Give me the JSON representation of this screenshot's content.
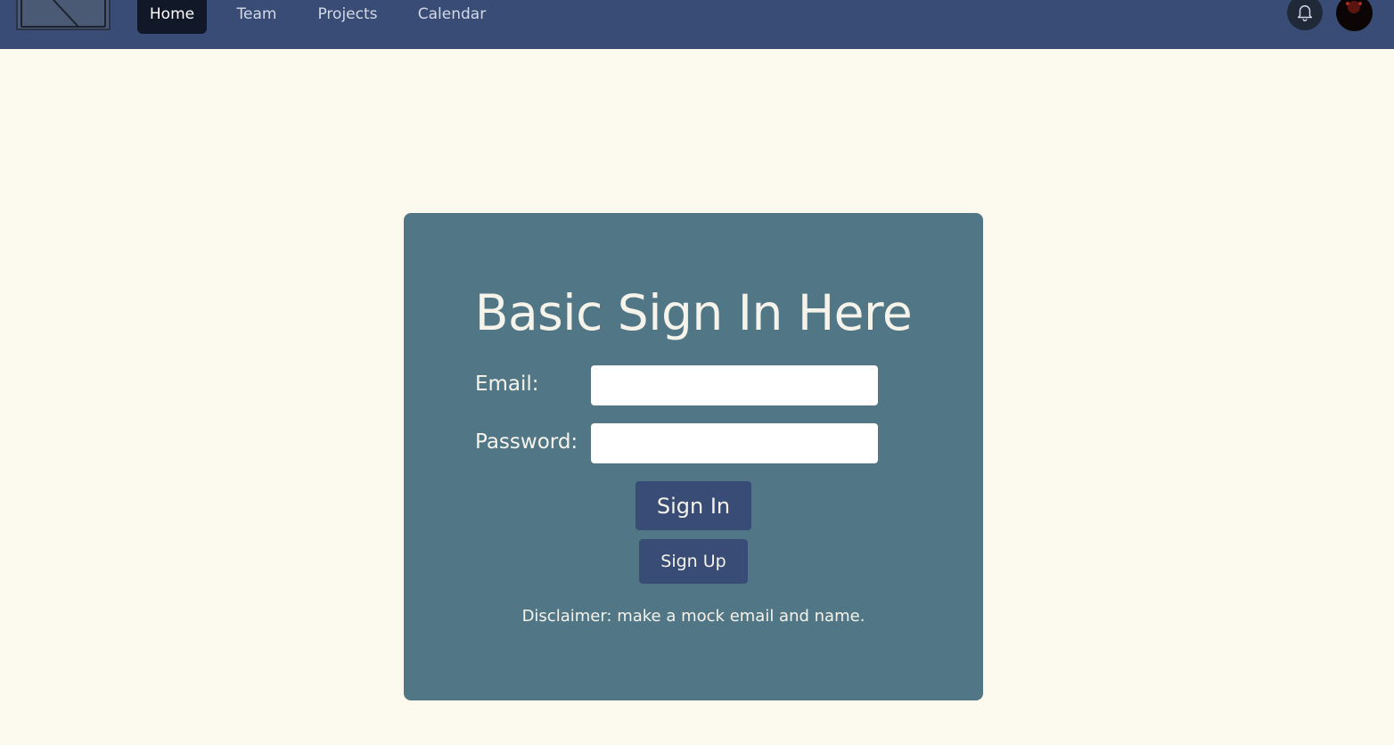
{
  "nav": {
    "items": [
      {
        "label": "Home",
        "active": true
      },
      {
        "label": "Team",
        "active": false
      },
      {
        "label": "Projects",
        "active": false
      },
      {
        "label": "Calendar",
        "active": false
      }
    ],
    "notification_icon": "bell-icon",
    "avatar": "user-avatar"
  },
  "form": {
    "title": "Basic Sign In Here",
    "email_label": "Email:",
    "email_value": "",
    "password_label": "Password:",
    "password_value": "",
    "sign_in_label": "Sign In",
    "sign_up_label": "Sign Up",
    "disclaimer": "Disclaimer: make a mock email and name."
  },
  "colors": {
    "navbar": "#384c75",
    "page_background": "#fcf9ee",
    "card": "#517686",
    "button": "#384c75",
    "active_tab": "#111827"
  }
}
